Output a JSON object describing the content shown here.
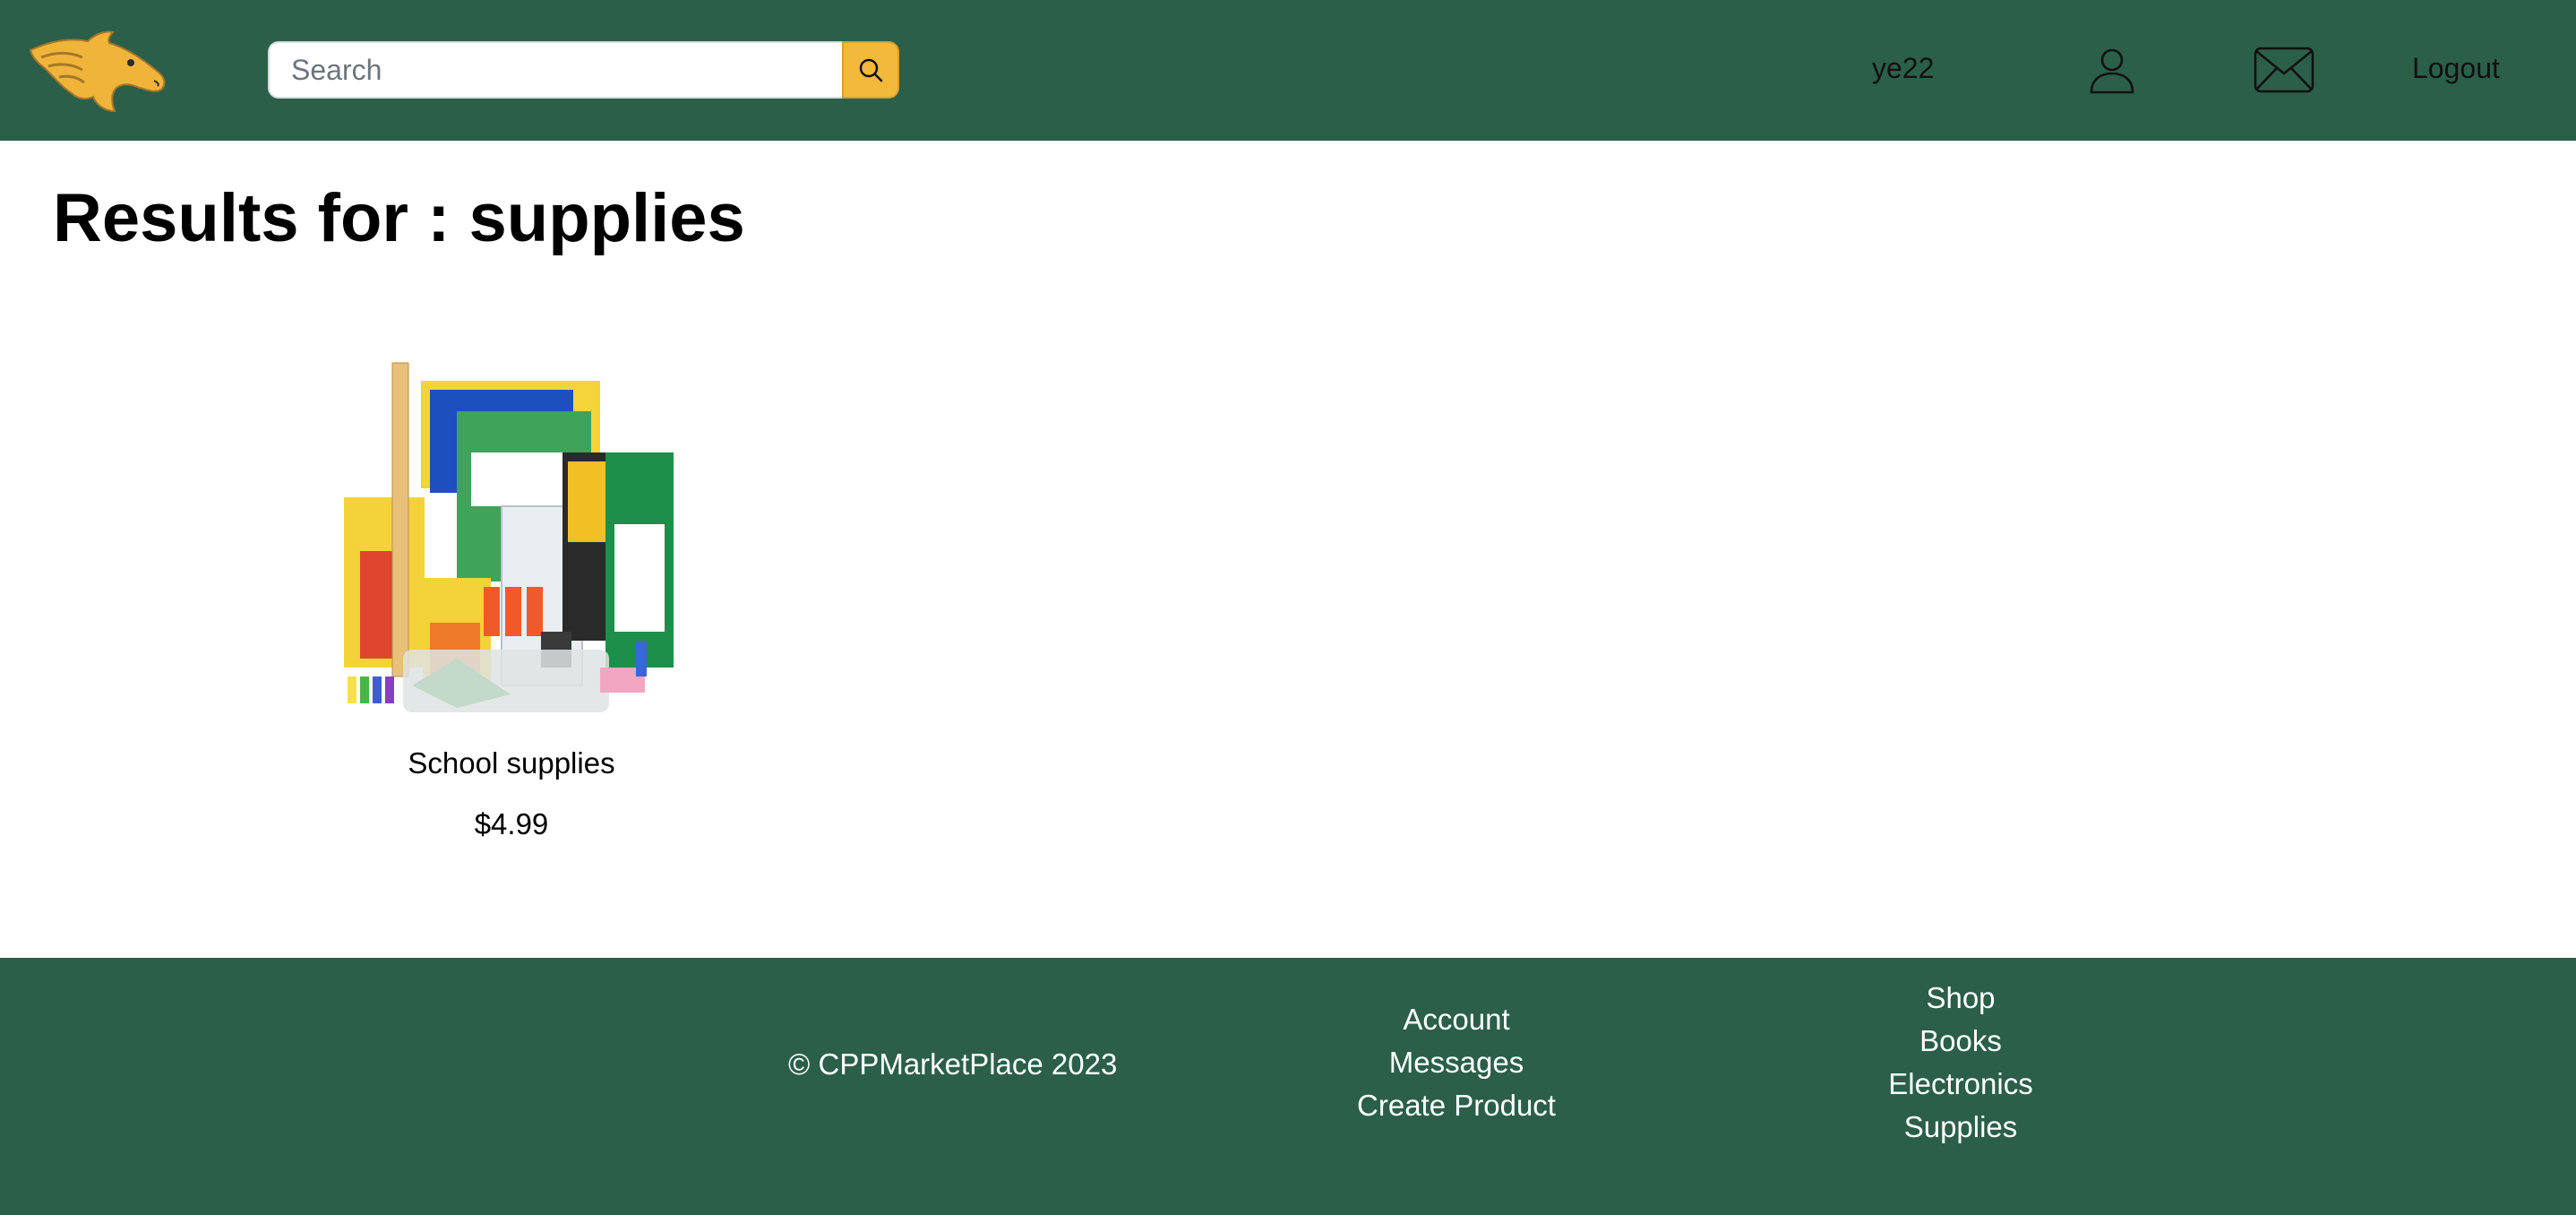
{
  "header": {
    "logo_icon": "mustang-horse-logo",
    "search": {
      "placeholder": "Search",
      "value": "",
      "button_icon": "search-icon"
    },
    "username": "ye22",
    "profile_icon": "user-icon",
    "messages_icon": "envelope-icon",
    "logout_label": "Logout"
  },
  "main": {
    "title": "Results for : supplies",
    "results": [
      {
        "name": "School supplies",
        "price": "$4.99",
        "image_icon": "school-supplies-image"
      }
    ]
  },
  "footer": {
    "copyright": "© CPPMarketPlace 2023",
    "links_account": [
      "Account",
      "Messages",
      "Create Product"
    ],
    "links_shop": [
      "Shop",
      "Books",
      "Electronics",
      "Supplies"
    ]
  },
  "colors": {
    "brand_green": "#2b5f49",
    "accent_gold": "#f2b93b"
  }
}
